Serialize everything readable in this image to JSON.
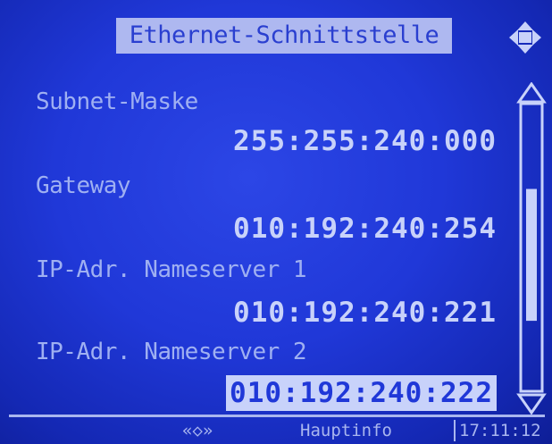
{
  "header": {
    "title": "Ethernet-Schnittstelle",
    "nav_icon": "four-way-arrow-icon"
  },
  "fields": [
    {
      "label": "Subnet-Maske",
      "value": "255:255:240:000",
      "selected": false
    },
    {
      "label": "Gateway",
      "value": "010:192:240:254",
      "selected": false
    },
    {
      "label": "IP-Adr. Nameserver 1",
      "value": "010:192:240:221",
      "selected": false
    },
    {
      "label": "IP-Adr. Nameserver 2",
      "value": "010:192:240:222",
      "selected": true
    }
  ],
  "scrollbar": {
    "position_fraction": 0.55,
    "thumb_fraction": 0.47
  },
  "footer": {
    "nav_arrows": "«◇»",
    "softkey_label": "Hauptinfo",
    "time": "17:11:12"
  },
  "colors": {
    "background": "#2038d8",
    "text": "#c8d2fa",
    "label": "#9fb0f2",
    "title_bg": "#aeb8f0"
  }
}
